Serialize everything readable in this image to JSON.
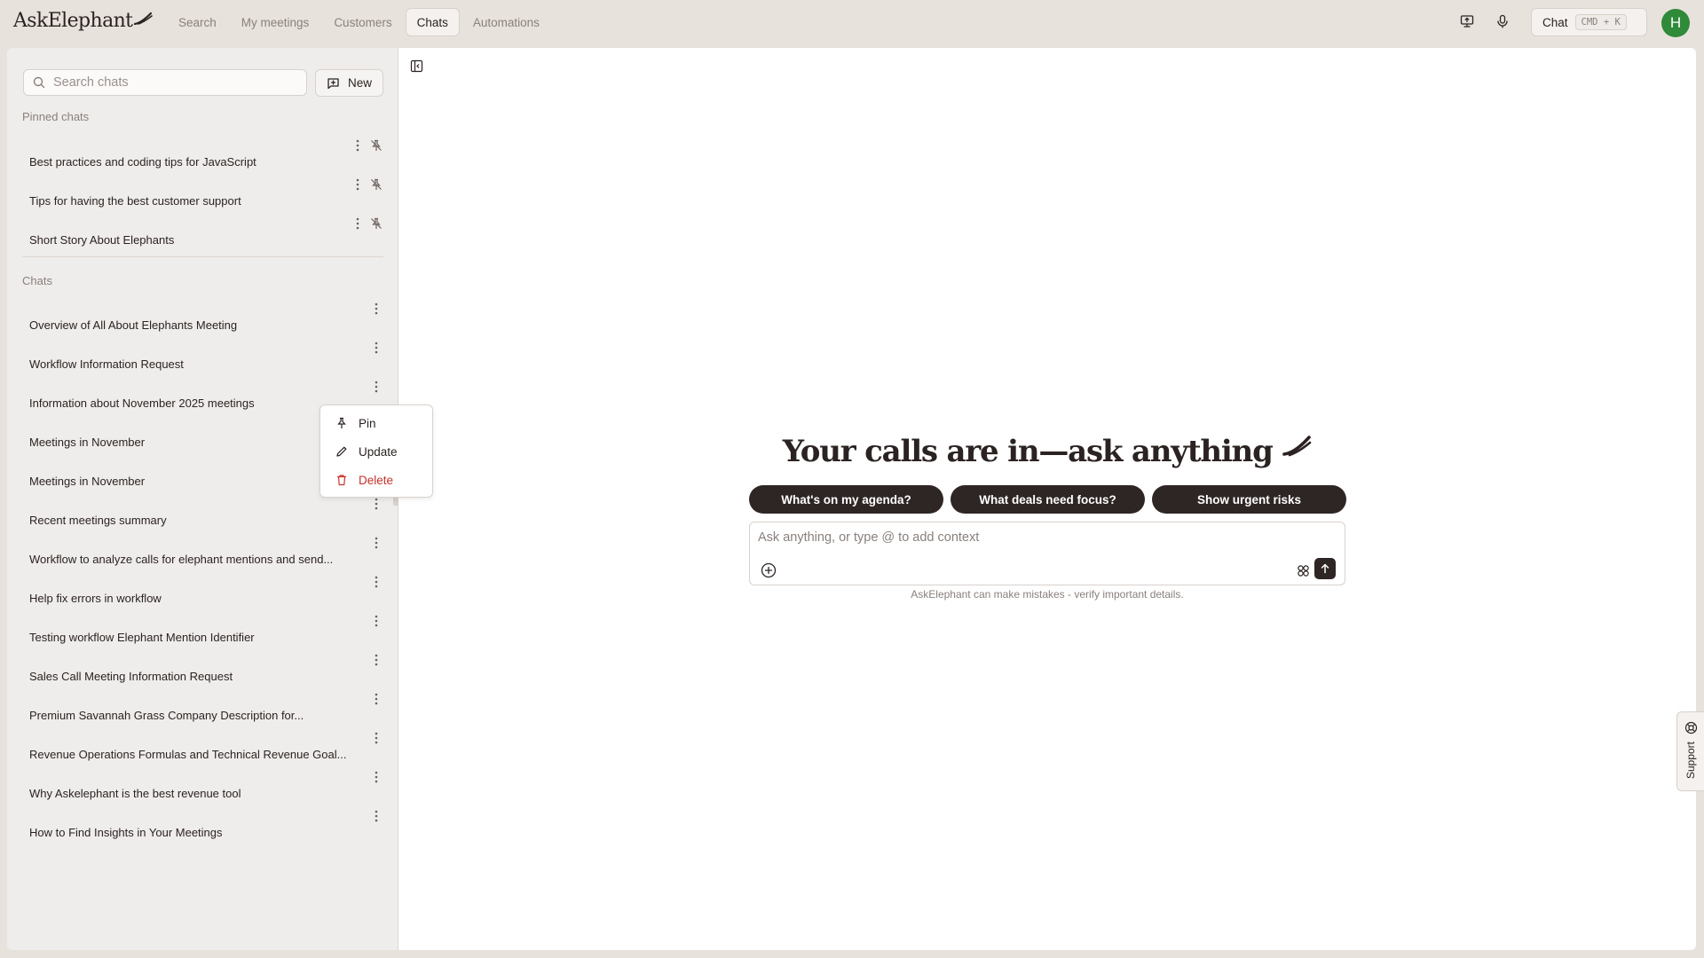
{
  "brand": {
    "name": "AskElephant"
  },
  "nav": [
    {
      "label": "Search",
      "active": false
    },
    {
      "label": "My meetings",
      "active": false
    },
    {
      "label": "Customers",
      "active": false
    },
    {
      "label": "Chats",
      "active": true
    },
    {
      "label": "Automations",
      "active": false
    }
  ],
  "topbar": {
    "chat_label": "Chat",
    "chat_shortcut": "CMD + K",
    "avatar_initial": "H",
    "avatar_color": "#2f8a3a"
  },
  "sidebar": {
    "search_placeholder": "Search chats",
    "new_label": "New",
    "pinned_label": "Pinned chats",
    "pinned": [
      "Best practices and coding tips for JavaScript",
      "Tips for having the best customer support",
      "Short Story About Elephants"
    ],
    "chats_label": "Chats",
    "chats": [
      "Overview of All About Elephants Meeting",
      "Workflow Information Request",
      "Information about November 2025 meetings",
      "Meetings in November",
      "Meetings in November",
      "Recent meetings summary",
      "Workflow to analyze calls for elephant mentions and send...",
      "Help fix errors in workflow",
      "Testing workflow Elephant Mention Identifier",
      "Sales Call Meeting Information Request",
      "Premium Savannah Grass Company Description for...",
      "Revenue Operations Formulas and Technical Revenue Goal...",
      "Why Askelephant is the best revenue tool",
      "How to Find Insights in Your Meetings"
    ]
  },
  "context_menu": {
    "pin": "Pin",
    "update": "Update",
    "delete": "Delete",
    "delete_color": "#c8322a"
  },
  "main": {
    "headline": "Your calls are in—ask anything",
    "suggestions": [
      "What's on my agenda?",
      "What deals need focus?",
      "Show urgent risks"
    ],
    "composer_placeholder": "Ask anything, or type @ to add context",
    "disclaimer": "AskElephant can make mistakes - verify important details."
  },
  "support": {
    "label": "Support"
  },
  "colors": {
    "accent_dark": "#2e2624",
    "chrome_bg": "#e8e2dd",
    "sidebar_bg": "#efedeb"
  }
}
